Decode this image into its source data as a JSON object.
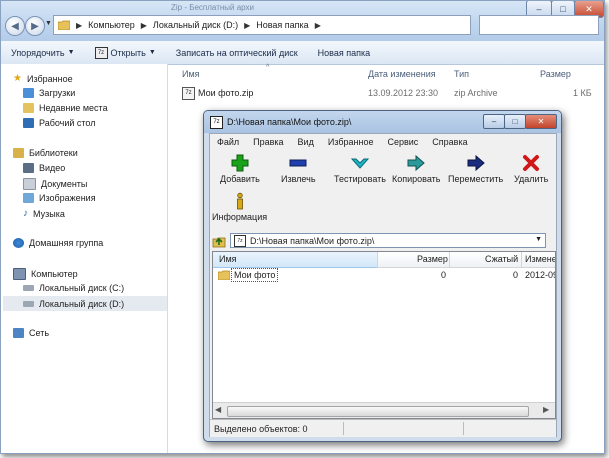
{
  "explorer": {
    "title_fragment": "Zip - Бесплатный архи",
    "nav_buttons": {
      "back": "◀",
      "forward": "▶"
    },
    "breadcrumb": [
      "Компьютер",
      "Локальный диск (D:)",
      "Новая папка"
    ],
    "command_bar": {
      "organize": "Упорядочить",
      "open": "Открыть",
      "burn": "Записать на оптический диск",
      "new_folder": "Новая папка"
    },
    "navigation": {
      "favorites": "Избранное",
      "downloads": "Загрузки",
      "recent": "Недавние места",
      "desktop": "Рабочий стол",
      "libraries": "Библиотеки",
      "video": "Видео",
      "documents": "Документы",
      "pictures": "Изображения",
      "music": "Музыка",
      "homegroup": "Домашняя группа",
      "computer": "Компьютер",
      "drive_c": "Локальный диск (C:)",
      "drive_d": "Локальный диск (D:)",
      "network": "Сеть"
    },
    "file_columns": [
      "Имя",
      "Дата изменения",
      "Тип",
      "Размер"
    ],
    "files": [
      {
        "name": "Мои фото.zip",
        "date": "13.09.2012 23:30",
        "type": "zip Archive",
        "size": "1 КБ"
      }
    ]
  },
  "zip": {
    "title": "D:\\Новая папка\\Мои фото.zip\\",
    "menu": [
      "Файл",
      "Правка",
      "Вид",
      "Избранное",
      "Сервис",
      "Справка"
    ],
    "toolbar": {
      "add": "Добавить",
      "extract": "Извлечь",
      "test": "Тестировать",
      "copy": "Копировать",
      "move": "Переместить",
      "delete": "Удалить",
      "info": "Информация"
    },
    "path": "D:\\Новая папка\\Мои фото.zip\\",
    "columns": [
      "Имя",
      "Размер",
      "Сжатый",
      "Измене"
    ],
    "rows": [
      {
        "name": "Мои фото",
        "size": "0",
        "packed": "0",
        "modified": "2012-09"
      }
    ],
    "status": "Выделено объектов: 0"
  },
  "colors": {
    "accent": "#2f6eb5",
    "add_green": "#1aa31a",
    "delete_red": "#d01818",
    "test_cyan": "#1bb6c7",
    "copy_teal": "#2a9a9a",
    "move_navy": "#1a2c80",
    "extract_blue": "#1f3fae"
  }
}
